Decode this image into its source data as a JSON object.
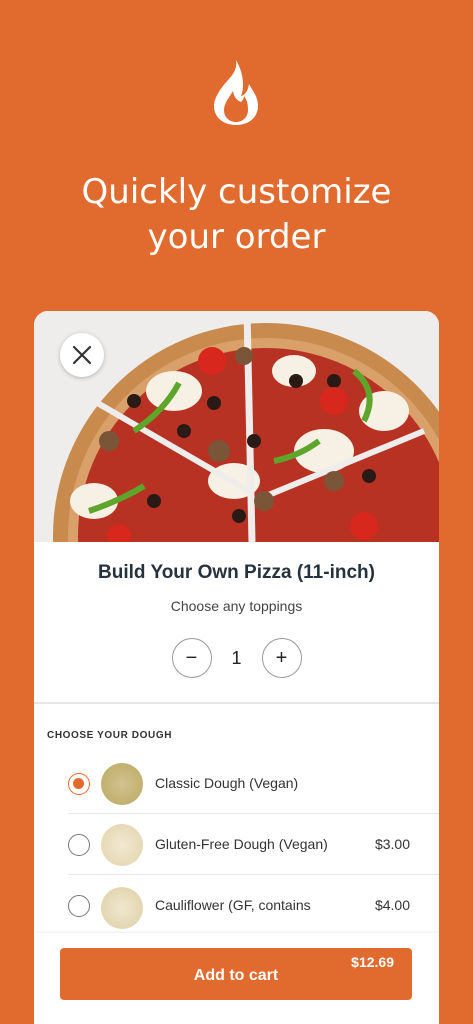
{
  "promo": {
    "headline_line1": "Quickly customize",
    "headline_line2": "your order",
    "icon": "flame-icon"
  },
  "item": {
    "title": "Build Your Own Pizza (11-inch)",
    "subtitle": "Choose any toppings",
    "quantity": "1",
    "decrement_label": "−",
    "increment_label": "+"
  },
  "dough": {
    "section_label": "CHOOSE YOUR DOUGH",
    "options": [
      {
        "label": "Classic Dough (Vegan)",
        "price": "",
        "selected": true
      },
      {
        "label": "Gluten-Free Dough (Vegan)",
        "price": "$3.00",
        "selected": false
      },
      {
        "label": "Cauliflower (GF, contains",
        "price": "$4.00",
        "selected": false
      }
    ]
  },
  "cart": {
    "button_label": "Add to cart",
    "price": "$12.69"
  },
  "colors": {
    "brand_orange": "#E16A2E",
    "title_navy": "#27323E"
  }
}
